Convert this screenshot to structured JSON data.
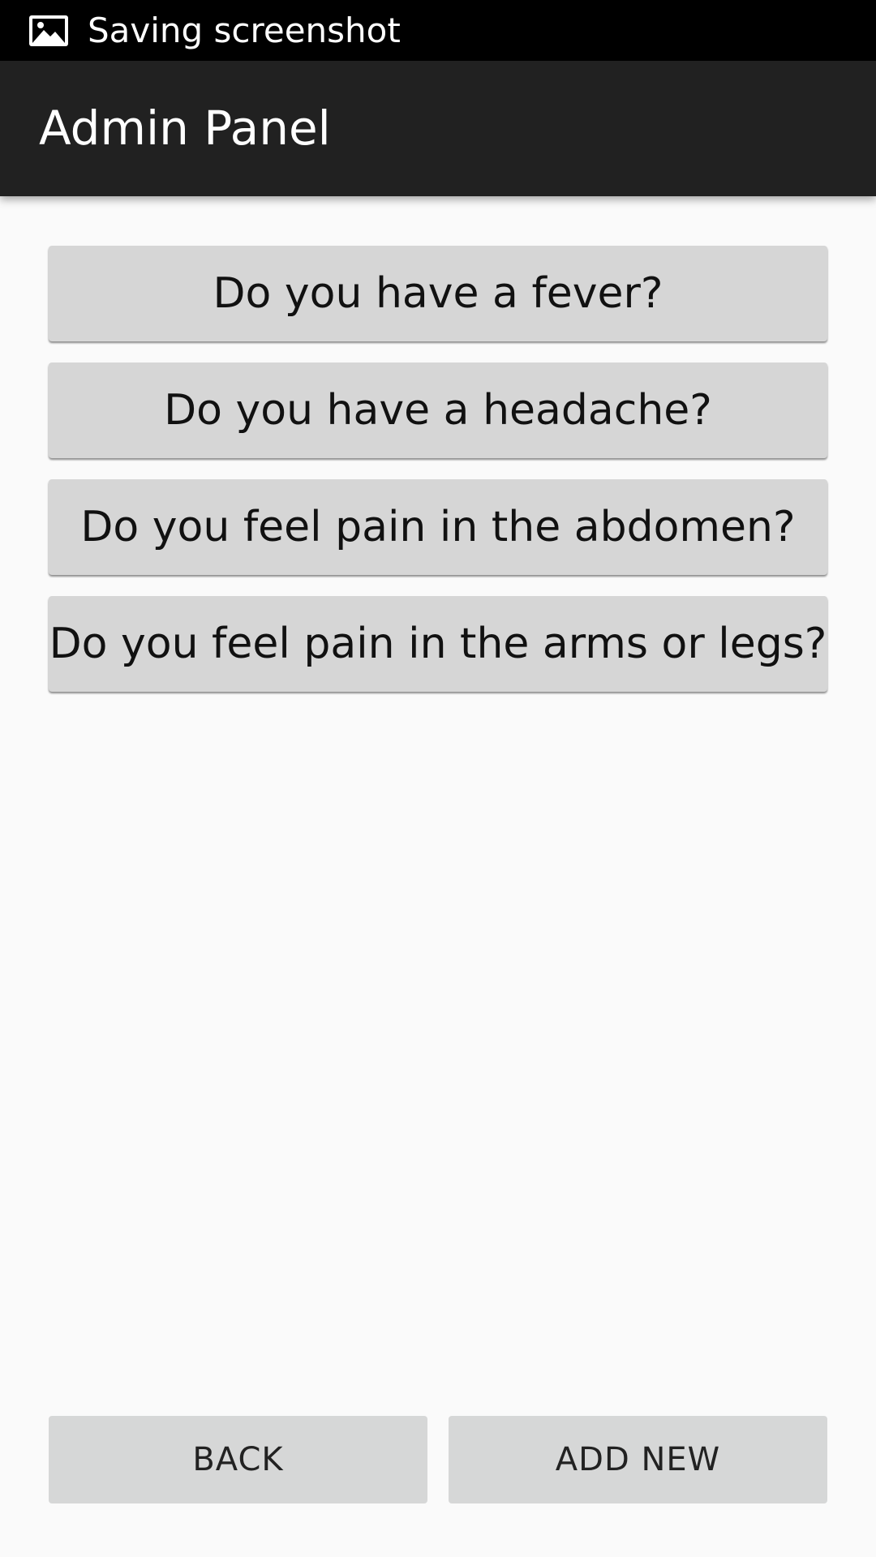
{
  "status_bar": {
    "icon": "image-icon",
    "text": "Saving screenshot"
  },
  "app_bar": {
    "title": "Admin Panel",
    "background": "#212121"
  },
  "questions": [
    {
      "label": "Do you have a fever?"
    },
    {
      "label": "Do you have a headache?"
    },
    {
      "label": "Do you feel pain in the abdomen?"
    },
    {
      "label": "Do you feel pain in the arms or legs?"
    }
  ],
  "actions": {
    "back_label": "BACK",
    "add_new_label": "ADD NEW"
  }
}
